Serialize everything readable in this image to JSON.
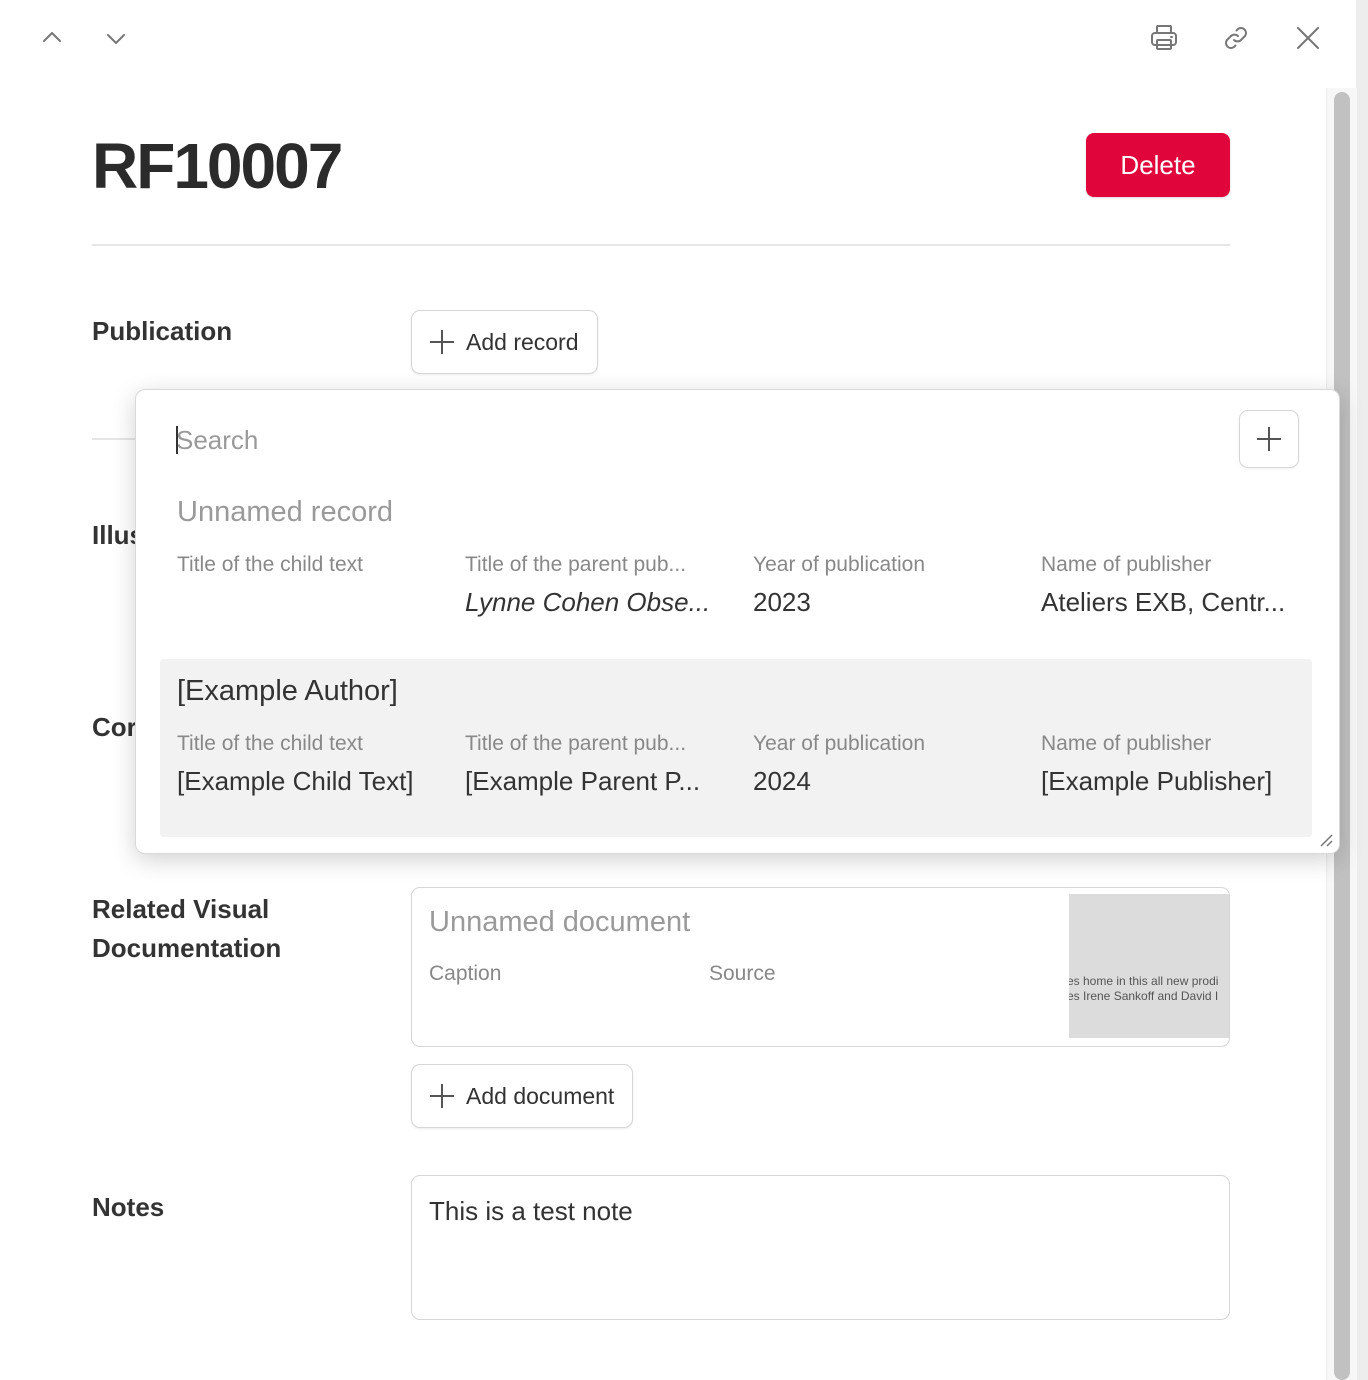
{
  "record": {
    "title": "RF10007",
    "delete_label": "Delete"
  },
  "fields": {
    "publication": {
      "label": "Publication",
      "add_label": "Add record"
    },
    "illustration": {
      "label": "Illus"
    },
    "contributor": {
      "label": "Cor"
    },
    "related_visual": {
      "label": "Related Visual Documentation",
      "document": {
        "title": "Unnamed document",
        "caption_label": "Caption",
        "source_label": "Source",
        "thumb_text_1": "es home in this all new prodi",
        "thumb_text_2": "es Irene Sankoff and David I"
      },
      "add_label": "Add document"
    },
    "notes": {
      "label": "Notes",
      "value": "This is a test note"
    }
  },
  "popup": {
    "search_placeholder": "Search",
    "results": [
      {
        "title": "Unnamed record",
        "columns": [
          {
            "label": "Title of the child text",
            "value": ""
          },
          {
            "label": "Title of the parent pub...",
            "value": "Lynne Cohen Obse..."
          },
          {
            "label": "Year of publication",
            "value": "2023"
          },
          {
            "label": "Name of publisher",
            "value": "Ateliers EXB, Centr..."
          }
        ]
      },
      {
        "title": "[Example Author]",
        "columns": [
          {
            "label": "Title of the child text",
            "value": "[Example Child Text]"
          },
          {
            "label": "Title of the parent pub...",
            "value": "[Example Parent P..."
          },
          {
            "label": "Year of publication",
            "value": "2024"
          },
          {
            "label": "Name of publisher",
            "value": "[Example Publisher]"
          }
        ]
      }
    ]
  },
  "icons": [
    "chevron-up-icon",
    "chevron-down-icon",
    "print-icon",
    "link-icon",
    "close-icon",
    "plus-icon",
    "resize-grip-icon"
  ],
  "colors": {
    "danger": "#e0063b",
    "highlight": "#f2f2f2",
    "muted_text": "#9a9a9a"
  }
}
